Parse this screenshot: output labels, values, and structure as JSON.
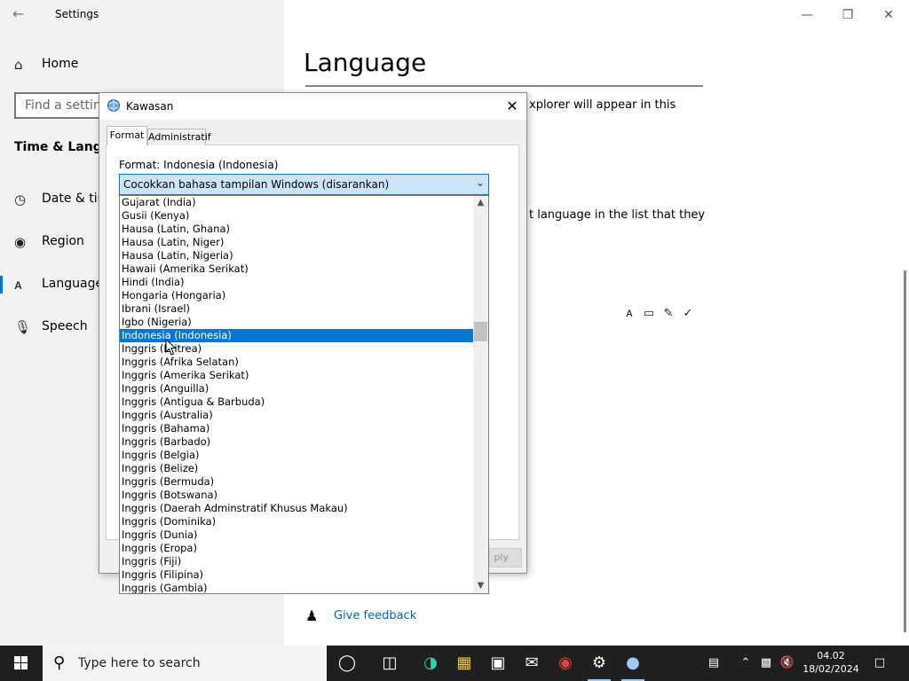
{
  "settings": {
    "app_title": "Settings",
    "nav": {
      "home": "Home",
      "search_placeholder": "Find a setting",
      "section_title": "Time & Language",
      "items": [
        {
          "label": "Date & time",
          "icon": "calendar-clock-icon"
        },
        {
          "label": "Region",
          "icon": "globe-icon"
        },
        {
          "label": "Language",
          "icon": "language-icon",
          "selected": true
        },
        {
          "label": "Speech",
          "icon": "microphone-icon"
        }
      ]
    },
    "content": {
      "title": "Language",
      "desc_line1": "xplorer will appear in this",
      "desc_line2": "t language in the list that they",
      "feedback_link": "Give feedback"
    }
  },
  "dialog": {
    "title": "Kawasan",
    "tabs": [
      "Format",
      "Administratif"
    ],
    "format_label": "Format: Indonesia (Indonesia)",
    "combo_value": "Cocokkan bahasa tampilan Windows (disarankan)",
    "apply_label": "ply",
    "options": [
      "Gujarat (India)",
      "Gusii (Kenya)",
      "Hausa (Latin, Ghana)",
      "Hausa (Latin, Niger)",
      "Hausa (Latin, Nigeria)",
      "Hawaii (Amerika Serikat)",
      "Hindi (India)",
      "Hongaria (Hongaria)",
      "Ibrani (Israel)",
      "Igbo (Nigeria)",
      "Indonesia (Indonesia)",
      "Inggris (Eritrea)",
      "Inggris (Afrika Selatan)",
      "Inggris (Amerika Serikat)",
      "Inggris (Anguilla)",
      "Inggris (Antigua & Barbuda)",
      "Inggris (Australia)",
      "Inggris (Bahama)",
      "Inggris (Barbado)",
      "Inggris (Belgia)",
      "Inggris (Belize)",
      "Inggris (Bermuda)",
      "Inggris (Botswana)",
      "Inggris (Daerah Adminstratif Khusus Makau)",
      "Inggris (Dominika)",
      "Inggris (Dunia)",
      "Inggris (Eropa)",
      "Inggris (Fiji)",
      "Inggris (Filipina)",
      "Inggris (Gambia)"
    ],
    "selected_option": "Indonesia (Indonesia)"
  },
  "taskbar": {
    "search_placeholder": "Type here to search",
    "time": "04.02",
    "date": "18/02/2024",
    "apps": [
      "task-view-icon",
      "edge-icon",
      "file-explorer-icon",
      "store-icon",
      "mail-icon",
      "chrome-icon",
      "settings-icon",
      "region-icon"
    ]
  },
  "colors": {
    "accent": "#0078d7",
    "link": "#0067c0",
    "selection_bg": "#0078d7",
    "combo_bg": "#cce4f7",
    "taskbar_bg": "#1f1f1f"
  }
}
